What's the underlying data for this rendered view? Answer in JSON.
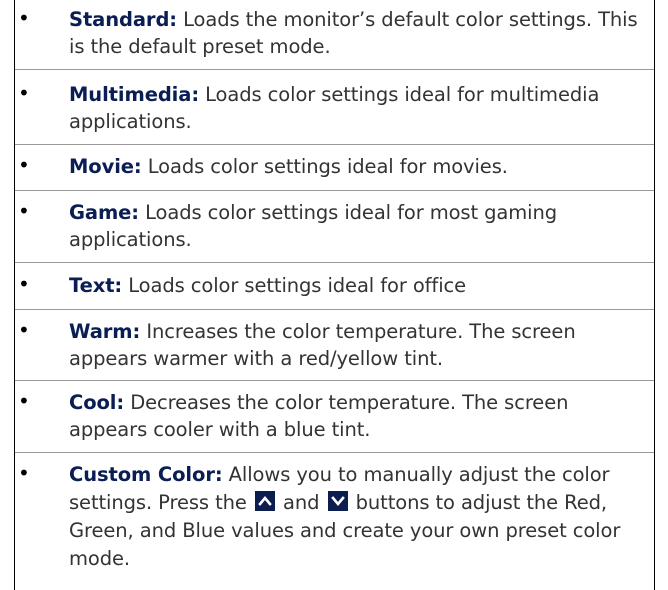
{
  "items": [
    {
      "term": "Standard:",
      "desc": "Loads the monitor’s default color settings. This is the default preset mode."
    },
    {
      "term": "Multimedia:",
      "desc": "Loads color settings ideal for multimedia applications."
    },
    {
      "term": "Movie:",
      "desc": "Loads color settings ideal for movies."
    },
    {
      "term": "Game:",
      "desc": "Loads color settings ideal for most gaming applications."
    },
    {
      "term": "Text:",
      "desc": "Loads color settings ideal for office"
    },
    {
      "term": "Warm:",
      "desc": "Increases the color temperature. The screen appears warmer with a red/yellow tint."
    },
    {
      "term": "Cool:",
      "desc": "Decreases the color temperature. The screen appears cooler with a blue tint."
    },
    {
      "term": "Custom Color:",
      "desc_part1": "Allows you to manually adjust the color settings. Press the",
      "desc_part2": "and",
      "desc_part3": "buttons to adjust the Red, Green, and Blue values and create your own preset color mode.",
      "icons": [
        "up-arrow-icon",
        "down-arrow-icon"
      ]
    }
  ],
  "bullet_char": "•",
  "colors": {
    "term": "#0a1e53",
    "text": "#333333",
    "icon_bg": "#0b1e4f"
  }
}
